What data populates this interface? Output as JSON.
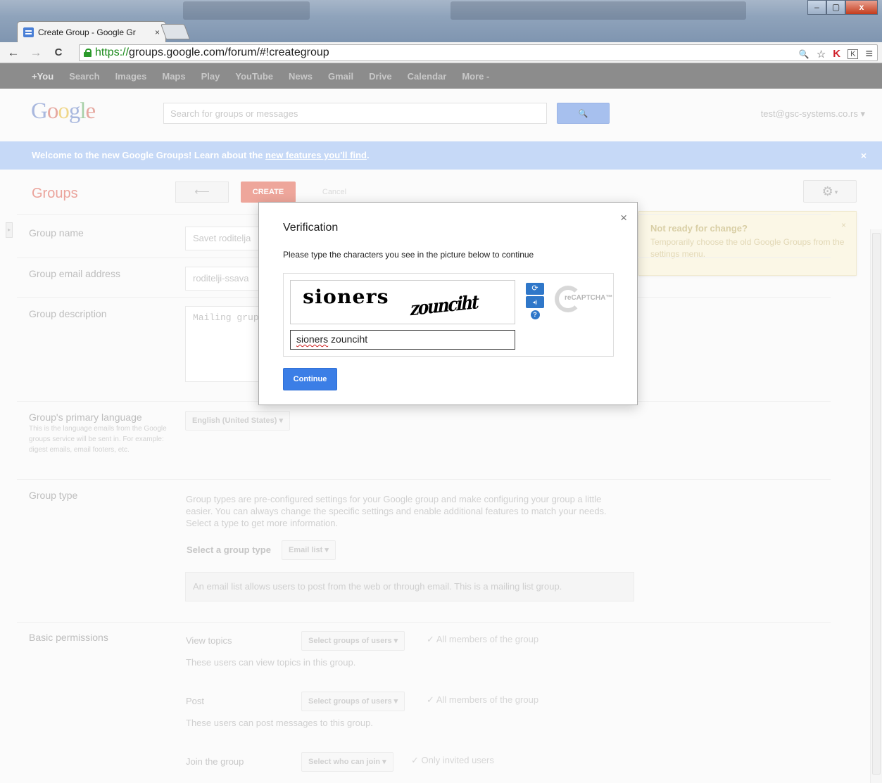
{
  "browser": {
    "tab_title": "Create Group - Google Gr",
    "tab_close": "×",
    "url_scheme": "https://",
    "url_rest": "groups.google.com/forum/#!creategroup",
    "back": "←",
    "forward": "→",
    "reload": "C",
    "window_min": "–",
    "window_max": "▢",
    "window_close": "x",
    "zoom_icon": "🔍",
    "star_icon": "☆",
    "menu_icon": "≡"
  },
  "gbar": {
    "items": [
      "+You",
      "Search",
      "Images",
      "Maps",
      "Play",
      "YouTube",
      "News",
      "Gmail",
      "Drive",
      "Calendar",
      "More -"
    ]
  },
  "header": {
    "logo": "Google",
    "search_placeholder": "Search for groups or messages",
    "search_button": "🔍",
    "account": "test@gsc-systems.co.rs ▾"
  },
  "welcome": {
    "text": "Welcome to the new Google Groups! Learn about the",
    "link": "new features you'll find",
    "trailing": ".",
    "close": "×"
  },
  "toolbar": {
    "groups_title": "Groups",
    "back_arrow": "⟵",
    "create": "CREATE",
    "cancel": "Cancel",
    "gear": "⚙"
  },
  "tip": {
    "title": "Not ready for change?",
    "body": "Temporarily choose the old Google Groups from the settings menu.",
    "close": "×"
  },
  "form": {
    "group_name_label": "Group name",
    "group_name_value": "Savet roditelja",
    "group_email_label": "Group email address",
    "group_email_value": "roditelji-ssava",
    "group_desc_label": "Group description",
    "group_desc_value": "Mailing grup",
    "language_label": "Group's primary language",
    "language_help": "This is the language emails from the Google groups service will be sent in. For example: digest emails, email footers, etc.",
    "language_value": "English (United States) ▾",
    "group_type_label": "Group type",
    "group_type_desc": "Group types are pre-configured settings for your Google group and make configuring your group a little easier. You can always change the specific settings and enable additional features to match your needs. Select a type to get more information.",
    "select_type_label": "Select a group type",
    "select_type_value": "Email list ▾",
    "type_info": "An email list allows users to post from the web or through email. This is a mailing list group.",
    "permissions_label": "Basic permissions",
    "view_topics_label": "View topics",
    "view_topics_select": "Select groups of users ▾",
    "view_topics_value": "All members of the group",
    "view_topics_help": "These users can view topics in this group.",
    "post_label": "Post",
    "post_select": "Select groups of users ▾",
    "post_value": "All members of the group",
    "post_help": "These users can post messages to this group.",
    "join_label": "Join the group",
    "join_select": "Select who can join ▾",
    "join_value": "Only invited users",
    "check": "✓"
  },
  "dialog": {
    "title": "Verification",
    "close": "×",
    "message": "Please type the characters you see in the picture below to continue",
    "captcha_word1": "sioners",
    "captcha_word2": "zounciht",
    "captcha_input_word1": "sioners",
    "captcha_input_word2": " zounciht",
    "refresh_icon": "⟳",
    "audio_icon": "◂)",
    "help_icon": "?",
    "recaptcha_label": "reCAPTCHA™",
    "continue": "Continue"
  },
  "colors": {
    "accent_blue": "#3b7ee6",
    "create_red": "#dd4b39"
  }
}
